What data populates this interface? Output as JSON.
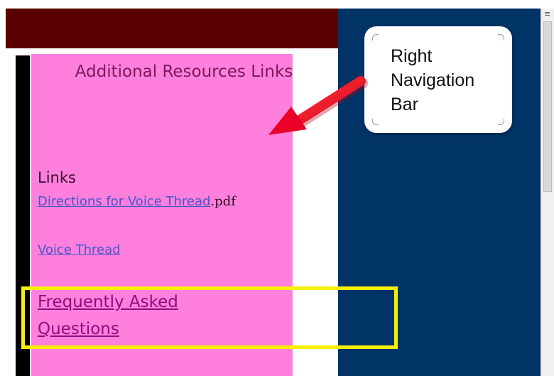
{
  "panel": {
    "title": "Additional Resources Links",
    "links_heading": "Links",
    "link_directions": "Directions for Voice Thread",
    "link_directions_suffix": ".pdf",
    "link_voice_thread": "Voice Thread",
    "link_faq": "Frequently Asked Questions"
  },
  "callout": {
    "line1": "Right",
    "line2": "Navigation",
    "line3": "Bar"
  },
  "scrollbar": {
    "grip_glyph": "≡"
  },
  "colors": {
    "header": "#5b0000",
    "right_nav": "#003366",
    "panel": "#ff7fdc",
    "highlight": "#f8f000",
    "arrow": "#e8002a",
    "link": "#4a57c9"
  },
  "icons": {
    "arrow": "red-arrow-icon",
    "scroll_grip": "scroll-grip-icon"
  }
}
